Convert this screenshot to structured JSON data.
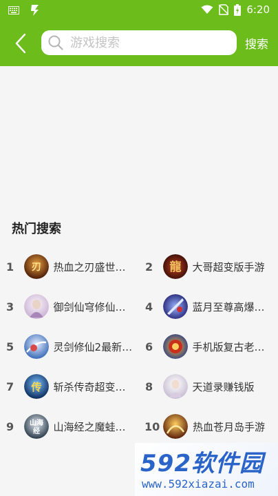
{
  "status_bar": {
    "time": "6:20",
    "icons": [
      "keyboard-icon",
      "app-notification-icon",
      "wifi-icon",
      "no-sim-icon",
      "battery-icon"
    ]
  },
  "header": {
    "search_placeholder": "游戏搜索",
    "search_button": "搜索",
    "accent_color": "#6cbc1c"
  },
  "hot_search": {
    "title": "热门搜索",
    "items": [
      {
        "rank": "1",
        "name": "热血之刃盛世…",
        "icon_color": "#7a3a12"
      },
      {
        "rank": "2",
        "name": "大哥超变版手游",
        "icon_color": "#6b1b10"
      },
      {
        "rank": "3",
        "name": "御剑仙穹修仙…",
        "icon_color": "#d8c7de"
      },
      {
        "rank": "4",
        "name": "蓝月至尊高爆…",
        "icon_color": "#3a3aa8"
      },
      {
        "rank": "5",
        "name": "灵剑修仙2最新…",
        "icon_color": "#4d7ec9"
      },
      {
        "rank": "6",
        "name": "手机版复古老…",
        "icon_color": "#c8401c"
      },
      {
        "rank": "7",
        "name": "斩杀传奇超变…",
        "icon_color": "#3a6ea8"
      },
      {
        "rank": "8",
        "name": "天道录赚钱版",
        "icon_color": "#e4dce8"
      },
      {
        "rank": "9",
        "name": "山海经之魔蛙…",
        "icon_color": "#5a6a7a"
      },
      {
        "rank": "10",
        "name": "热血苍月岛手游",
        "icon_color": "#b8651a"
      }
    ]
  },
  "watermark": {
    "brand": "592软件园",
    "url": "www.592xiazai.com"
  }
}
